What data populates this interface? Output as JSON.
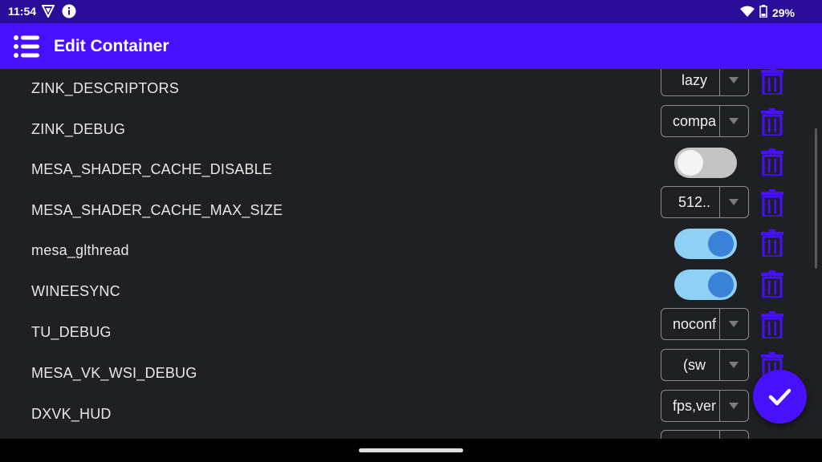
{
  "status": {
    "time": "11:54",
    "battery": "29%",
    "icons": [
      "shield-icon",
      "info-icon",
      "wifi-icon",
      "battery-icon"
    ]
  },
  "appbar": {
    "title": "Edit Container",
    "menu_icon": "menu-icon"
  },
  "colors": {
    "accent": "#4711ff",
    "statusbar": "#2a0e9a",
    "background": "#1f2023",
    "toggle_on": "#8fd0f5",
    "knob_on": "#3a82d8"
  },
  "env_vars": [
    {
      "name": "ZINK_DESCRIPTORS",
      "type": "select",
      "value": "lazy"
    },
    {
      "name": "ZINK_DEBUG",
      "type": "select",
      "value": "compa"
    },
    {
      "name": "MESA_SHADER_CACHE_DISABLE",
      "type": "toggle",
      "checked": false
    },
    {
      "name": "MESA_SHADER_CACHE_MAX_SIZE",
      "type": "select",
      "value": "512.."
    },
    {
      "name": "mesa_glthread",
      "type": "toggle",
      "checked": true
    },
    {
      "name": "WINEESYNC",
      "type": "toggle",
      "checked": true
    },
    {
      "name": "TU_DEBUG",
      "type": "select",
      "value": "noconf"
    },
    {
      "name": "MESA_VK_WSI_DEBUG",
      "type": "select",
      "value": "(sw"
    },
    {
      "name": "DXVK_HUD",
      "type": "select",
      "value": "fps,ver"
    }
  ],
  "fab": {
    "icon": "check-icon"
  }
}
